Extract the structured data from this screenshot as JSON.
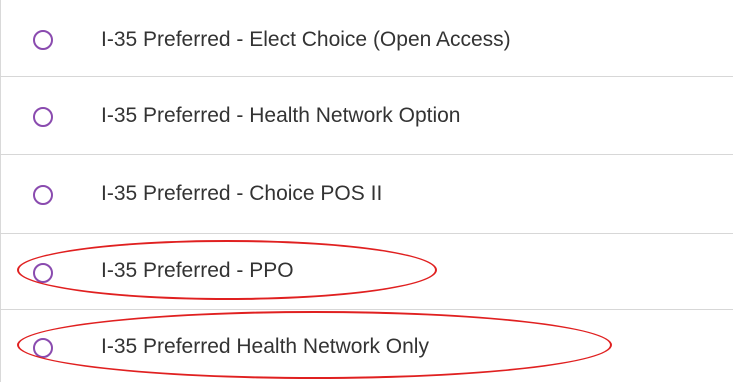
{
  "plan_options": [
    {
      "label": "I-35 Preferred - Elect Choice (Open Access)",
      "selected": false,
      "highlighted": false
    },
    {
      "label": "I-35 Preferred - Health Network Option",
      "selected": false,
      "highlighted": false
    },
    {
      "label": "I-35 Preferred - Choice POS II",
      "selected": false,
      "highlighted": false
    },
    {
      "label": "I-35 Preferred - PPO",
      "selected": false,
      "highlighted": true
    },
    {
      "label": "I-35 Preferred Health Network Only",
      "selected": false,
      "highlighted": true
    }
  ],
  "colors": {
    "radio_border": "#8a4baf",
    "row_divider": "#d7d7d7",
    "highlight": "#e02020",
    "text": "#333333"
  }
}
